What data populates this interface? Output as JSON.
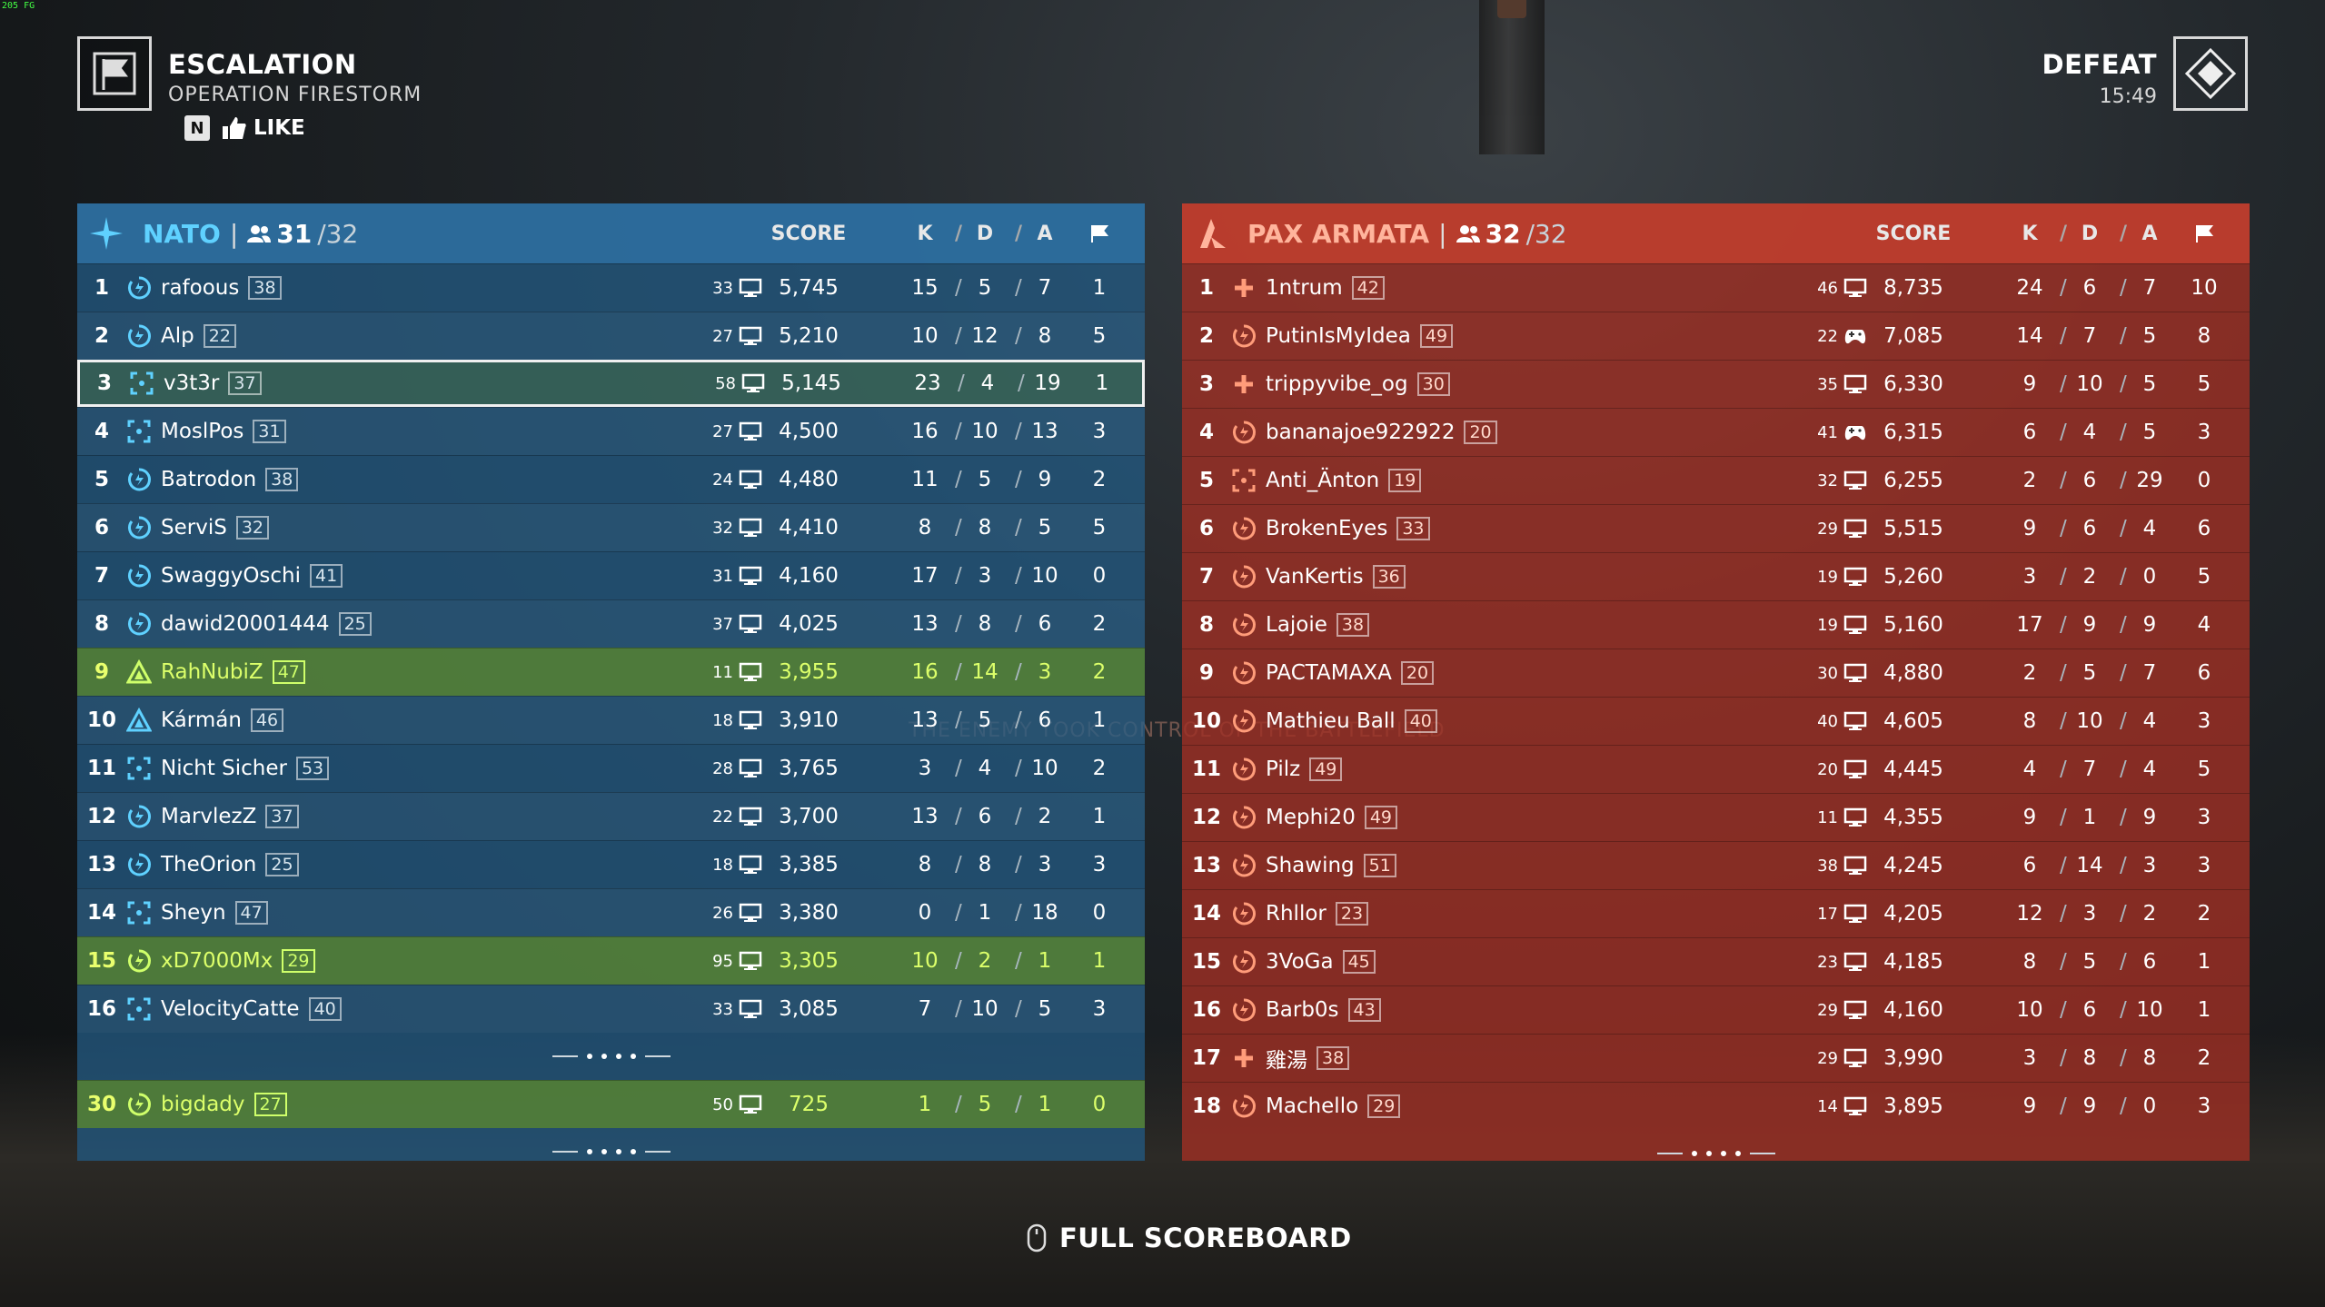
{
  "fps_label": "205 FG",
  "header": {
    "mode": "ESCALATION",
    "map": "OPERATION FIRESTORM",
    "like_key": "N",
    "like_label": "LIKE",
    "result": "DEFEAT",
    "time": "15:49"
  },
  "overlay_text": "THE ENEMY TOOK CONTROL OF THE BATTLEFIELD",
  "footer": {
    "full_scoreboard": "FULL SCOREBOARD"
  },
  "colors": {
    "nato_accent": "#5fd1ff",
    "pax_accent": "#ffb49c",
    "squad_highlight": "#dcff6a"
  },
  "columns": {
    "score": "SCORE",
    "k": "K",
    "d": "D",
    "a": "A",
    "sep": "/"
  },
  "nato": {
    "name": "NATO",
    "count_sep": "|",
    "players": "31",
    "max": "/32",
    "rows": [
      {
        "rank": "1",
        "cls": "support",
        "name": "rafoous",
        "lvl": "38",
        "ping": "33",
        "dev": "pc",
        "score": "5,745",
        "k": "15",
        "d": "5",
        "a": "7",
        "flag": "1",
        "hl": ""
      },
      {
        "rank": "2",
        "cls": "support",
        "name": "Alp",
        "lvl": "22",
        "ping": "27",
        "dev": "pc",
        "score": "5,210",
        "k": "10",
        "d": "12",
        "a": "8",
        "flag": "5",
        "hl": ""
      },
      {
        "rank": "3",
        "cls": "recon",
        "name": "v3t3r",
        "lvl": "37",
        "ping": "58",
        "dev": "pc",
        "score": "5,145",
        "k": "23",
        "d": "4",
        "a": "19",
        "flag": "1",
        "hl": "self"
      },
      {
        "rank": "4",
        "cls": "recon",
        "name": "MoslPos",
        "lvl": "31",
        "ping": "27",
        "dev": "pc",
        "score": "4,500",
        "k": "16",
        "d": "10",
        "a": "13",
        "flag": "3",
        "hl": ""
      },
      {
        "rank": "5",
        "cls": "support",
        "name": "Batrodon",
        "lvl": "38",
        "ping": "24",
        "dev": "pc",
        "score": "4,480",
        "k": "11",
        "d": "5",
        "a": "9",
        "flag": "2",
        "hl": ""
      },
      {
        "rank": "6",
        "cls": "support",
        "name": "ServiS",
        "lvl": "32",
        "ping": "32",
        "dev": "pc",
        "score": "4,410",
        "k": "8",
        "d": "8",
        "a": "5",
        "flag": "5",
        "hl": ""
      },
      {
        "rank": "7",
        "cls": "support",
        "name": "SwaggyOschi",
        "lvl": "41",
        "ping": "31",
        "dev": "pc",
        "score": "4,160",
        "k": "17",
        "d": "3",
        "a": "10",
        "flag": "0",
        "hl": ""
      },
      {
        "rank": "8",
        "cls": "support",
        "name": "dawid20001444",
        "lvl": "25",
        "ping": "37",
        "dev": "pc",
        "score": "4,025",
        "k": "13",
        "d": "8",
        "a": "6",
        "flag": "2",
        "hl": ""
      },
      {
        "rank": "9",
        "cls": "assault",
        "name": "RahNubiZ",
        "lvl": "47",
        "ping": "11",
        "dev": "pc",
        "score": "3,955",
        "k": "16",
        "d": "14",
        "a": "3",
        "flag": "2",
        "hl": "squad"
      },
      {
        "rank": "10",
        "cls": "assault",
        "name": "Kármán",
        "lvl": "46",
        "ping": "18",
        "dev": "pc",
        "score": "3,910",
        "k": "13",
        "d": "5",
        "a": "6",
        "flag": "1",
        "hl": ""
      },
      {
        "rank": "11",
        "cls": "recon",
        "name": "Nicht Sicher",
        "lvl": "53",
        "ping": "28",
        "dev": "pc",
        "score": "3,765",
        "k": "3",
        "d": "4",
        "a": "10",
        "flag": "2",
        "hl": ""
      },
      {
        "rank": "12",
        "cls": "support",
        "name": "MarvlezZ",
        "lvl": "37",
        "ping": "22",
        "dev": "pc",
        "score": "3,700",
        "k": "13",
        "d": "6",
        "a": "2",
        "flag": "1",
        "hl": ""
      },
      {
        "rank": "13",
        "cls": "support",
        "name": "TheOrion",
        "lvl": "25",
        "ping": "18",
        "dev": "pc",
        "score": "3,385",
        "k": "8",
        "d": "8",
        "a": "3",
        "flag": "3",
        "hl": ""
      },
      {
        "rank": "14",
        "cls": "recon",
        "name": "Sheyn",
        "lvl": "47",
        "ping": "26",
        "dev": "pc",
        "score": "3,380",
        "k": "0",
        "d": "1",
        "a": "18",
        "flag": "0",
        "hl": ""
      },
      {
        "rank": "15",
        "cls": "support",
        "name": "xD7000Mx",
        "lvl": "29",
        "ping": "95",
        "dev": "pc",
        "score": "3,305",
        "k": "10",
        "d": "2",
        "a": "1",
        "flag": "1",
        "hl": "squad"
      },
      {
        "rank": "16",
        "cls": "recon",
        "name": "VelocityCatte",
        "lvl": "40",
        "ping": "33",
        "dev": "pc",
        "score": "3,085",
        "k": "7",
        "d": "10",
        "a": "5",
        "flag": "3",
        "hl": ""
      }
    ],
    "extra_row": {
      "rank": "30",
      "cls": "support",
      "name": "bigdady",
      "lvl": "27",
      "ping": "50",
      "dev": "pc",
      "score": "725",
      "k": "1",
      "d": "5",
      "a": "1",
      "flag": "0",
      "hl": "squad"
    }
  },
  "pax": {
    "name": "PAX ARMATA",
    "count_sep": "|",
    "players": "32",
    "max": "/32",
    "rows": [
      {
        "rank": "1",
        "cls": "medic",
        "name": "1ntrum",
        "lvl": "42",
        "ping": "46",
        "dev": "pc",
        "score": "8,735",
        "k": "24",
        "d": "6",
        "a": "7",
        "flag": "10"
      },
      {
        "rank": "2",
        "cls": "support",
        "name": "PutinIsMyIdea",
        "lvl": "49",
        "ping": "22",
        "dev": "pad",
        "score": "7,085",
        "k": "14",
        "d": "7",
        "a": "5",
        "flag": "8"
      },
      {
        "rank": "3",
        "cls": "medic",
        "name": "trippyvibe_og",
        "lvl": "30",
        "ping": "35",
        "dev": "pc",
        "score": "6,330",
        "k": "9",
        "d": "10",
        "a": "5",
        "flag": "5"
      },
      {
        "rank": "4",
        "cls": "support",
        "name": "bananajoe922922",
        "lvl": "20",
        "ping": "41",
        "dev": "pad",
        "score": "6,315",
        "k": "6",
        "d": "4",
        "a": "5",
        "flag": "3"
      },
      {
        "rank": "5",
        "cls": "recon",
        "name": "Anti_Änton",
        "lvl": "19",
        "ping": "32",
        "dev": "pc",
        "score": "6,255",
        "k": "2",
        "d": "6",
        "a": "29",
        "flag": "0"
      },
      {
        "rank": "6",
        "cls": "support",
        "name": "BrokenEyes",
        "lvl": "33",
        "ping": "29",
        "dev": "pc",
        "score": "5,515",
        "k": "9",
        "d": "6",
        "a": "4",
        "flag": "6"
      },
      {
        "rank": "7",
        "cls": "support",
        "name": "VanKertis",
        "lvl": "36",
        "ping": "19",
        "dev": "pc",
        "score": "5,260",
        "k": "3",
        "d": "2",
        "a": "0",
        "flag": "5"
      },
      {
        "rank": "8",
        "cls": "support",
        "name": "Lajoie",
        "lvl": "38",
        "ping": "19",
        "dev": "pc",
        "score": "5,160",
        "k": "17",
        "d": "9",
        "a": "9",
        "flag": "4"
      },
      {
        "rank": "9",
        "cls": "support",
        "name": "PACTAMAXA",
        "lvl": "20",
        "ping": "30",
        "dev": "pc",
        "score": "4,880",
        "k": "2",
        "d": "5",
        "a": "7",
        "flag": "6"
      },
      {
        "rank": "10",
        "cls": "support",
        "name": "Mathieu Ball",
        "lvl": "40",
        "ping": "40",
        "dev": "pc",
        "score": "4,605",
        "k": "8",
        "d": "10",
        "a": "4",
        "flag": "3"
      },
      {
        "rank": "11",
        "cls": "support",
        "name": "Pilz",
        "lvl": "49",
        "ping": "20",
        "dev": "pc",
        "score": "4,445",
        "k": "4",
        "d": "7",
        "a": "4",
        "flag": "5"
      },
      {
        "rank": "12",
        "cls": "support",
        "name": "Mephi20",
        "lvl": "49",
        "ping": "11",
        "dev": "pc",
        "score": "4,355",
        "k": "9",
        "d": "1",
        "a": "9",
        "flag": "3"
      },
      {
        "rank": "13",
        "cls": "support",
        "name": "Shawing",
        "lvl": "51",
        "ping": "38",
        "dev": "pc",
        "score": "4,245",
        "k": "6",
        "d": "14",
        "a": "3",
        "flag": "3"
      },
      {
        "rank": "14",
        "cls": "support",
        "name": "Rhllor",
        "lvl": "23",
        "ping": "17",
        "dev": "pc",
        "score": "4,205",
        "k": "12",
        "d": "3",
        "a": "2",
        "flag": "2"
      },
      {
        "rank": "15",
        "cls": "support",
        "name": "3VoGa",
        "lvl": "45",
        "ping": "23",
        "dev": "pc",
        "score": "4,185",
        "k": "8",
        "d": "5",
        "a": "6",
        "flag": "1"
      },
      {
        "rank": "16",
        "cls": "support",
        "name": "Barb0s",
        "lvl": "43",
        "ping": "29",
        "dev": "pc",
        "score": "4,160",
        "k": "10",
        "d": "6",
        "a": "10",
        "flag": "1"
      },
      {
        "rank": "17",
        "cls": "medic",
        "name": "雞湯",
        "lvl": "38",
        "ping": "29",
        "dev": "pc",
        "score": "3,990",
        "k": "3",
        "d": "8",
        "a": "8",
        "flag": "2"
      },
      {
        "rank": "18",
        "cls": "support",
        "name": "Machello",
        "lvl": "29",
        "ping": "14",
        "dev": "pc",
        "score": "3,895",
        "k": "9",
        "d": "9",
        "a": "0",
        "flag": "3"
      }
    ]
  }
}
